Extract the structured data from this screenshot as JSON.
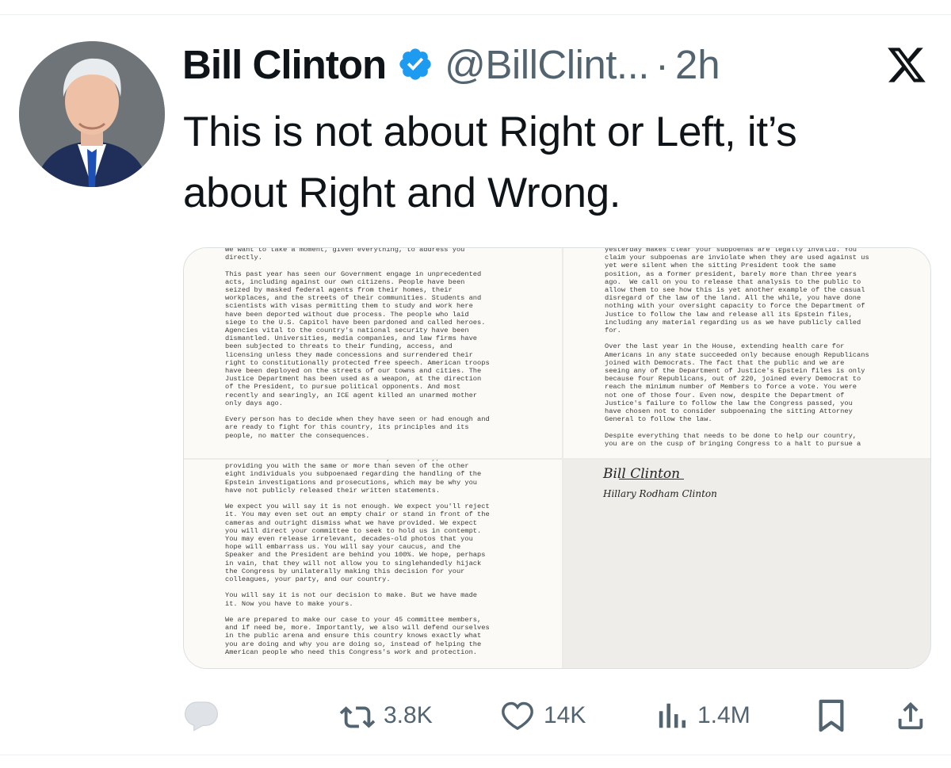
{
  "author": {
    "name": "Bill Clinton",
    "handle": "@BillClint...",
    "separator": "·",
    "time": "2h"
  },
  "icons": {
    "verified": "verified-badge-icon",
    "platform": "x-logo-icon",
    "reply": "reply-icon",
    "retweet": "retweet-icon",
    "like": "heart-icon",
    "views": "views-icon",
    "bookmark": "bookmark-icon",
    "share": "share-icon"
  },
  "colors": {
    "verified": "#1d9bf0",
    "text": "#0f1419",
    "muted": "#536471"
  },
  "tweet": {
    "text": "This is not about Right or Left, it’s about Right and Wrong."
  },
  "media": {
    "page1": "We want to take a moment, given everything, to address you\ndirectly.\n\nThis past year has seen our Government engage in unprecedented\nacts, including against our own citizens. People have been\nseized by masked federal agents from their homes, their\nworkplaces, and the streets of their communities. Students and\nscientists with visas permitting them to study and work here\nhave been deported without due process. The people who laid\nsiege to the U.S. Capitol have been pardoned and called heroes.\nAgencies vital to the country's national security have been\ndismantled. Universities, media companies, and law firms have\nbeen subjected to threats to their funding, access, and\nlicensing unless they made concessions and surrendered their\nright to constitutionally protected free speech. American troops\nhave been deployed on the streets of our towns and cities. The\nJustice Department has been used as a weapon, at the direction\nof the President, to pursue political opponents. And most\nrecently and searingly, an ICE agent killed an unarmed mother\nonly days ago.\n\nEvery person has to decide when they have seen or had enough and\nare ready to fight for this country, its principles and its\npeople, no matter the consequences.",
    "page2": "yesterday makes clear your subpoenas are legally invalid. You\nclaim your subpoenas are inviolate when they are used against us\nyet were silent when the sitting President took the same\nposition, as a former president, barely more than three years\nago.  We call on you to release that analysis to the public to\nallow them to see how this is yet another example of the casual\ndisregard of the law of the land. All the while, you have done\nnothing with your oversight capacity to force the Department of\nJustice to follow the law and release all its Epstein files,\nincluding any material regarding us as we have publicly called\nfor.\n\nOver the last year in the House, extending health care for\nAmericans in any state succeeded only because enough Republicans\njoined with Democrats. The fact that the public and we are\nseeing any of the Department of Justice's Epstein files is only\nbecause four Republicans, out of 220, joined every Democrat to\nreach the minimum number of Members to force a vote. You were\nnot one of those four. Even now, despite the Department of\nJustice's failure to follow the law the Congress passed, you\nhave chosen not to consider subpoenaing the sitting Attorney\nGeneral to follow the law.\n\nDespite everything that needs to be done to help our country,\nyou are on the cusp of bringing Congress to a halt to pursue a",
    "page3": "You have asked what we know. To answer your inquiry, we are\nproviding you with the same or more than seven of the other\neight individuals you subpoenaed regarding the handling of the\nEpstein investigations and prosecutions, which may be why you\nhave not publicly released their written statements.\n\nWe expect you will say it is not enough. We expect you'll reject\nit. You may even set out an empty chair or stand in front of the\ncameras and outright dismiss what we have provided. We expect\nyou will direct your committee to seek to hold us in contempt.\nYou may even release irrelevant, decades-old photos that you\nhope will embarrass us. You will say your caucus, and the\nSpeaker and the President are behind you 100%. We hope, perhaps\nin vain, that they will not allow you to singlehandedly hijack\nthe Congress by unilaterally making this decision for your\ncolleagues, your party, and our country.\n\nYou will say it is not our decision to make. But we have made\nit. Now you have to make yours.\n\nWe are prepared to make our case to your 45 committee members,\nand if need be, more. Importantly, we also will defend ourselves\nin the public arena and ensure this country knows exactly what\nyou are doing and why you are doing so, instead of helping the\nAmerican people who need this Congress's work and protection.",
    "signature1": "Bill Clinton",
    "signature2": "Hillary Rodham Clinton"
  },
  "actions": {
    "reply_count": "",
    "retweet_count": "3.8K",
    "like_count": "14K",
    "view_count": "1.4M"
  }
}
